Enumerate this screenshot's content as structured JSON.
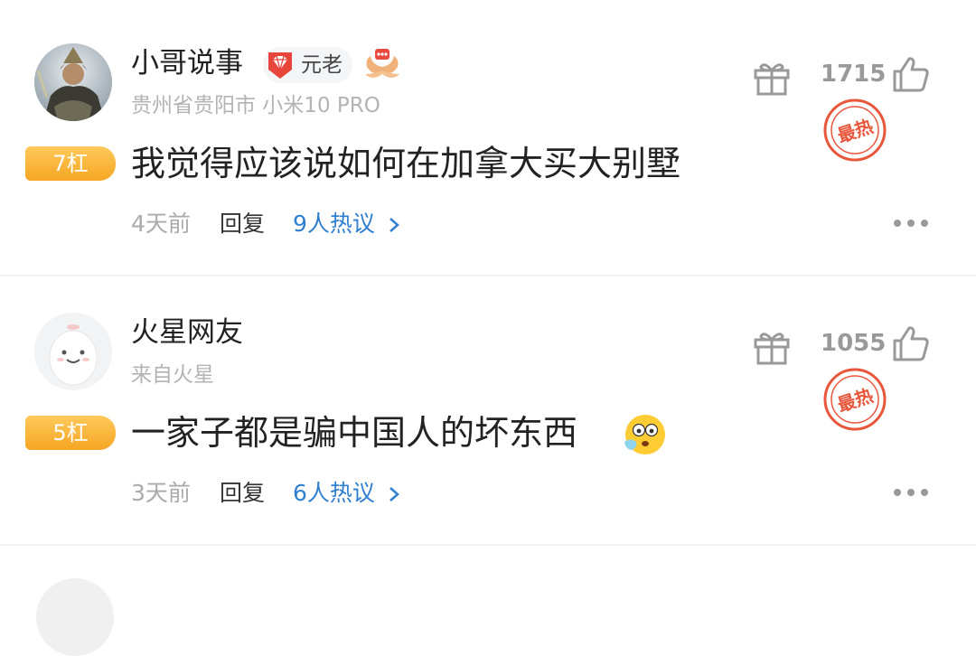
{
  "comments": [
    {
      "username": "小哥说事",
      "badge_label": "元老",
      "meta": "贵州省贵阳市  小米10 PRO",
      "rank": "7杠",
      "content": "我觉得应该说如何在加拿大买大别墅",
      "time": "4天前",
      "reply": "回复",
      "discuss": "9人热议",
      "likes": "1715",
      "hot_label": "最热"
    },
    {
      "username": "火星网友",
      "meta": "来自火星",
      "rank": "5杠",
      "content": "一家子都是骗中国人的坏东西",
      "time": "3天前",
      "reply": "回复",
      "discuss": "6人热议",
      "likes": "1055",
      "hot_label": "最热"
    }
  ],
  "colors": {
    "accent_blue": "#2f7fd1",
    "rank_orange": "#f5a623",
    "hot_red": "#e8573c"
  },
  "icons": [
    "gift-icon",
    "thumbs-up-icon",
    "more-dots-icon",
    "gem-badge-icon",
    "wings-icon",
    "flushed-emoji-icon"
  ]
}
